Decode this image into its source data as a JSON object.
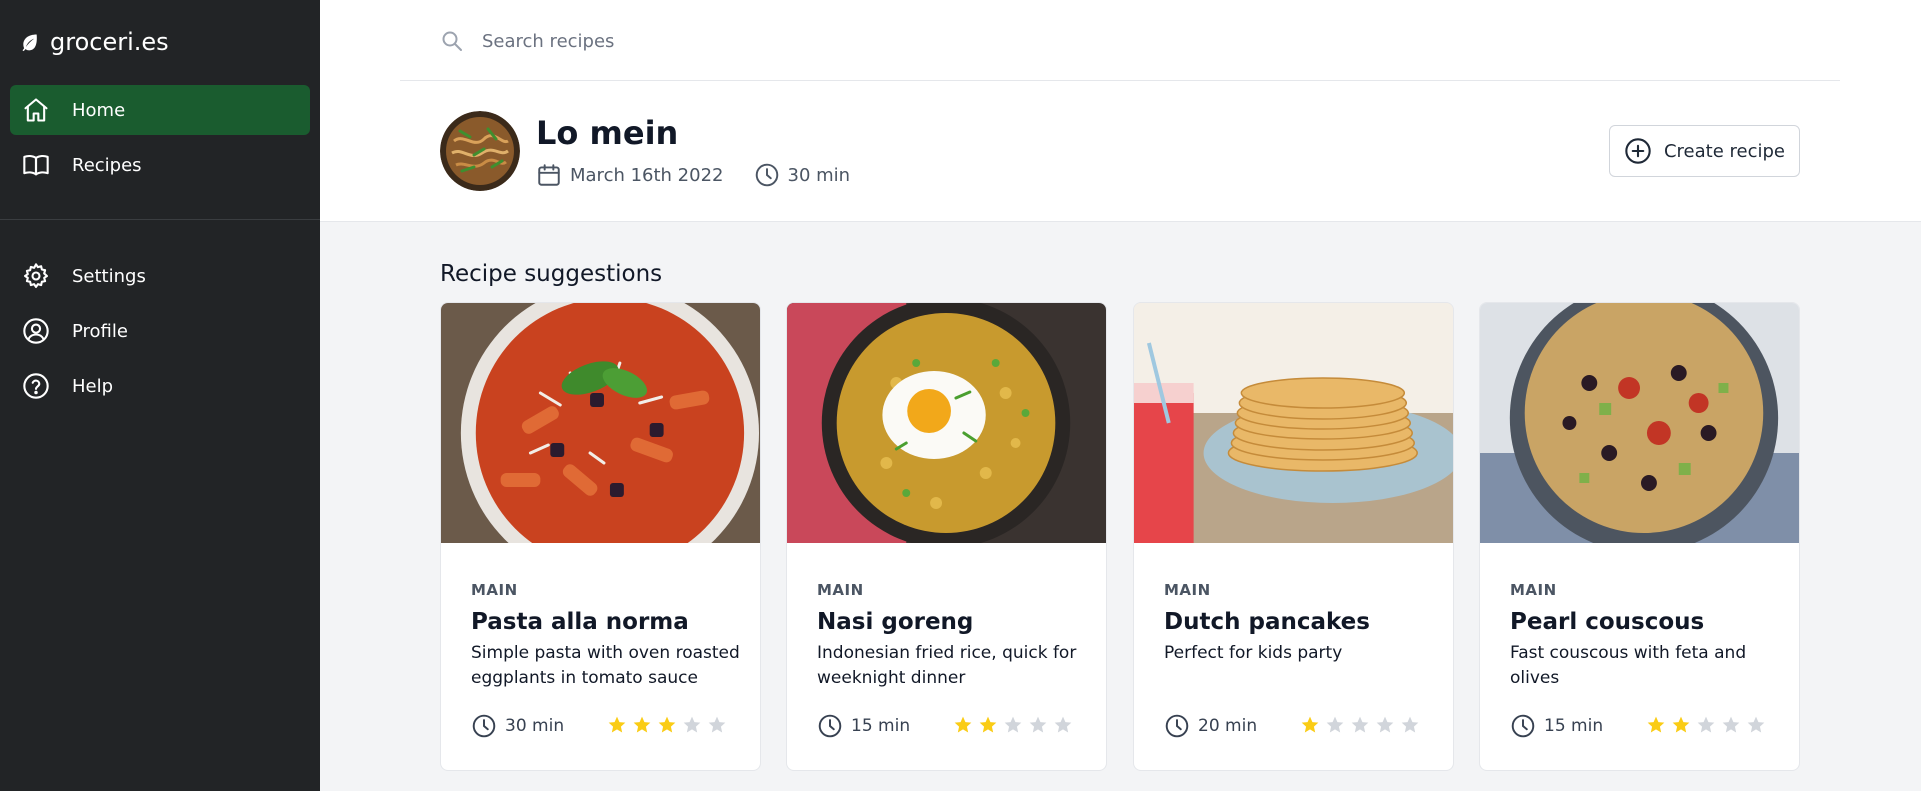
{
  "app": {
    "brand": "groceri.es"
  },
  "sidebar": {
    "items": [
      {
        "label": "Home",
        "active": true
      },
      {
        "label": "Recipes"
      },
      {
        "label": "Settings"
      },
      {
        "label": "Profile"
      },
      {
        "label": "Help"
      }
    ]
  },
  "search": {
    "placeholder": "Search recipes"
  },
  "header": {
    "title": "Lo mein",
    "date": "March 16th 2022",
    "duration": "30 min",
    "create_label": "Create recipe"
  },
  "suggestions": {
    "title": "Recipe suggestions",
    "cards": [
      {
        "category": "MAIN",
        "title": "Pasta alla norma",
        "description": "Simple pasta with oven roasted eggplants in tomato sauce",
        "time": "30 min",
        "rating": 3
      },
      {
        "category": "MAIN",
        "title": "Nasi goreng",
        "description": "Indonesian fried rice, quick for weeknight dinner",
        "time": "15 min",
        "rating": 2
      },
      {
        "category": "MAIN",
        "title": "Dutch pancakes",
        "description": "Perfect for kids party",
        "time": "20 min",
        "rating": 1
      },
      {
        "category": "MAIN",
        "title": "Pearl couscous",
        "description": "Fast couscous with feta and olives",
        "time": "15 min",
        "rating": 2
      }
    ]
  },
  "colors": {
    "sidebar_bg": "#222426",
    "active_nav": "#1a5c2f",
    "star_filled": "#facc15",
    "star_empty": "#d1d5db"
  }
}
